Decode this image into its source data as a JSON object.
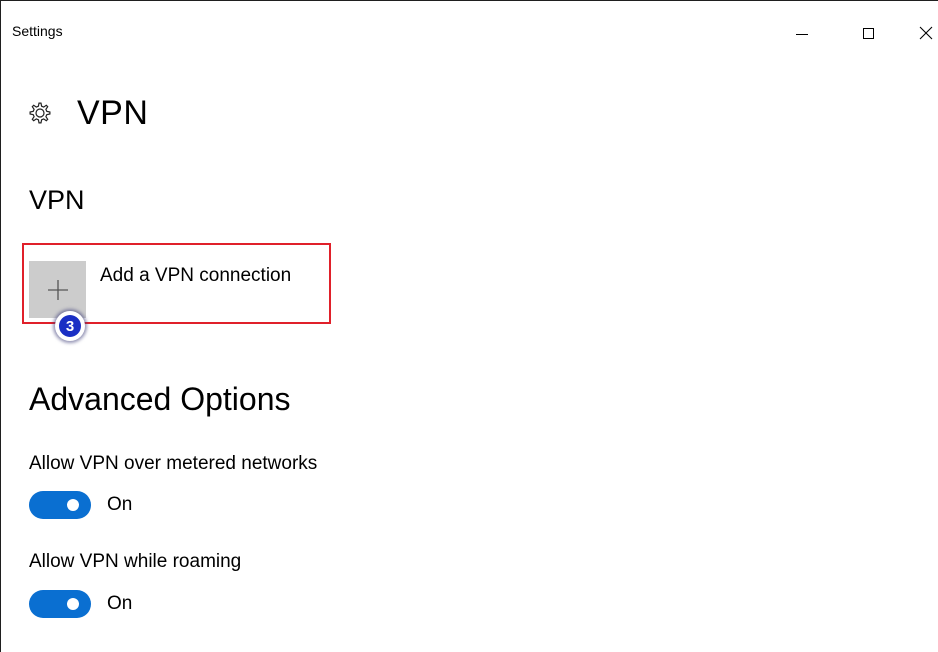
{
  "window": {
    "title": "Settings"
  },
  "header": {
    "icon": "gear-icon",
    "title": "VPN"
  },
  "vpn_section": {
    "title": "VPN",
    "add_connection_label": "Add a VPN connection",
    "add_icon": "plus-icon",
    "step_badge": "3"
  },
  "advanced": {
    "title": "Advanced Options",
    "settings": [
      {
        "label": "Allow VPN over metered networks",
        "state": "On",
        "enabled": true
      },
      {
        "label": "Allow VPN while roaming",
        "state": "On",
        "enabled": true
      }
    ]
  },
  "colors": {
    "accent": "#0a6fd1",
    "highlight": "#e0202a",
    "badge": "#1a2fc4",
    "tile": "#cccccc"
  }
}
